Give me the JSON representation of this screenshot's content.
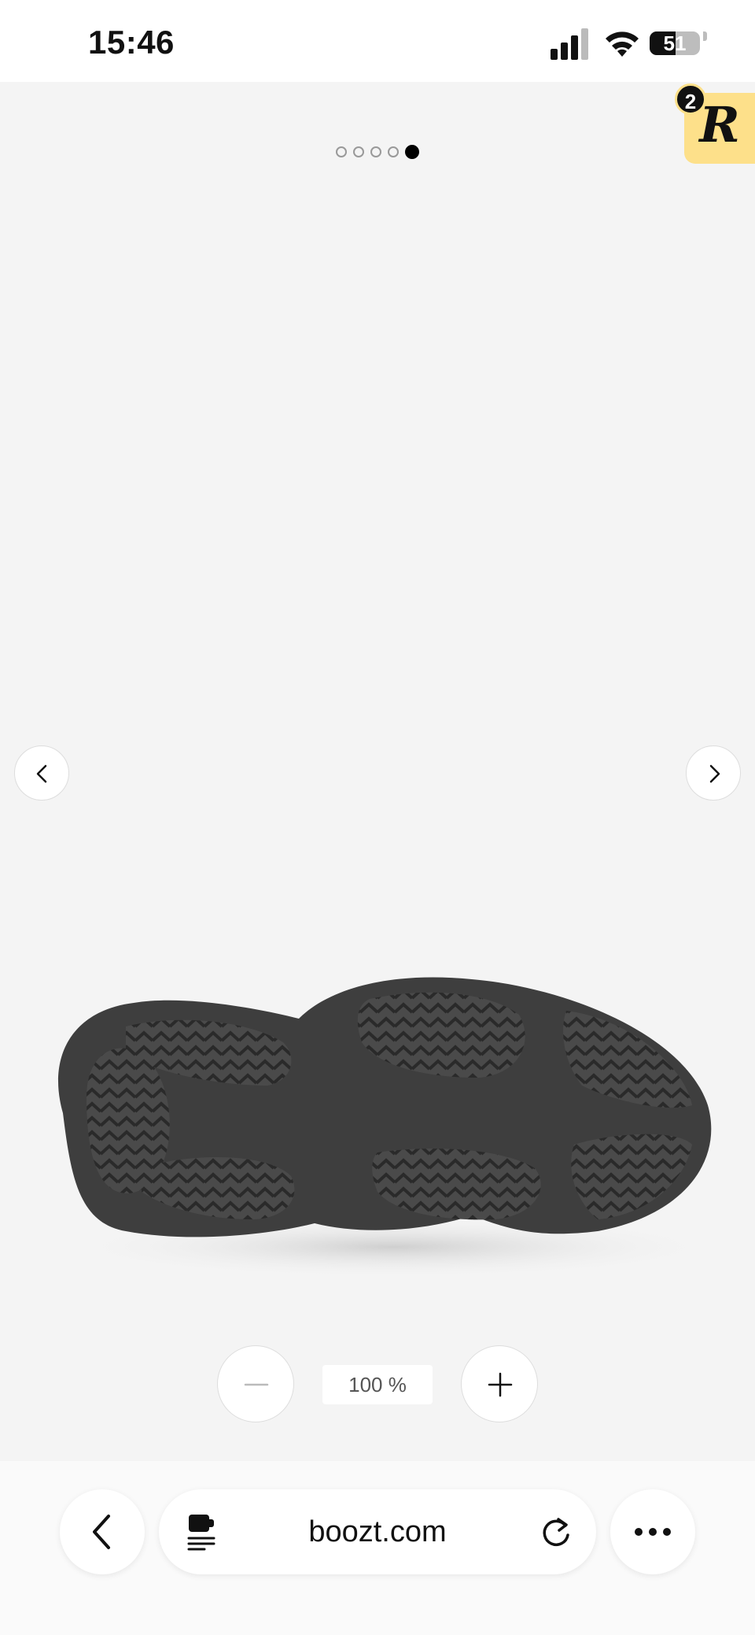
{
  "status_bar": {
    "time": "15:46",
    "battery": "51",
    "battery_level": 0.51,
    "icons": [
      "cellular-signal-icon",
      "wifi-icon",
      "battery-icon"
    ]
  },
  "gallery": {
    "image_count": 5,
    "active_index": 5,
    "image": "shoe-sole-icon",
    "prev_icon": "chevron-left-icon",
    "next_icon": "chevron-right-icon"
  },
  "extension_badge": {
    "letter": "R",
    "count": "2",
    "color": "#fde08a"
  },
  "zoom": {
    "level": "100 %",
    "minus_icon": "minus-icon",
    "plus_icon": "plus-icon"
  },
  "browser": {
    "domain": "boozt.com",
    "icons": [
      "back-icon",
      "page-menu-icon",
      "reload-icon",
      "more-icon"
    ]
  }
}
